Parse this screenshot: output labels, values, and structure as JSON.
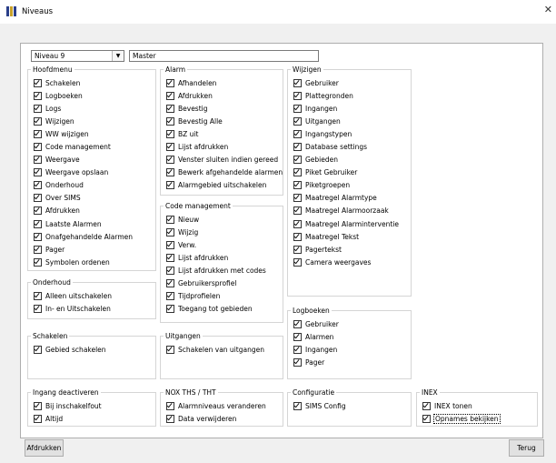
{
  "window": {
    "title": "Niveaus",
    "close_glyph": "✕"
  },
  "level_select": {
    "value": "Niveau 9"
  },
  "level_name": {
    "value": "Master"
  },
  "groups": {
    "hoofdmenu": {
      "title": "Hoofdmenu",
      "items": [
        "Schakelen",
        "Logboeken",
        "Logs",
        "Wijzigen",
        "WW wijzigen",
        "Code management",
        "Weergave",
        "Weergave opslaan",
        "Onderhoud",
        "Over SIMS",
        "Afdrukken",
        "Laatste Alarmen",
        "Onafgehandelde Alarmen",
        "Pager",
        "Symbolen ordenen"
      ]
    },
    "onderhoud": {
      "title": "Onderhoud",
      "items": [
        "Alleen uitschakelen",
        "In- en Uitschakelen"
      ]
    },
    "schakelen": {
      "title": "Schakelen",
      "items": [
        "Gebied schakelen"
      ]
    },
    "ingang": {
      "title": "Ingang deactiveren",
      "items": [
        "Bij inschakelfout",
        "Altijd"
      ]
    },
    "alarm": {
      "title": "Alarm",
      "items": [
        "Afhandelen",
        "Afdrukken",
        "Bevestig",
        "Bevestig Alle",
        "BZ uit",
        "Lijst afdrukken",
        "Venster sluiten indien gereed",
        "Bewerk afgehandelde alarmen",
        "Alarmgebied uitschakelen"
      ]
    },
    "code": {
      "title": "Code management",
      "items": [
        "Nieuw",
        "Wijzig",
        "Verw.",
        "Lijst afdrukken",
        "Lijst afdrukken met codes",
        "Gebruikersprofiel",
        "Tijdprofielen",
        "Toegang tot gebieden"
      ]
    },
    "uitgangen": {
      "title": "Uitgangen",
      "items": [
        "Schakelen van uitgangen"
      ]
    },
    "nox": {
      "title": "NOX THS / THT",
      "items": [
        "Alarmniveaus veranderen",
        "Data verwijderen"
      ]
    },
    "wijzigen": {
      "title": "Wijzigen",
      "items": [
        "Gebruiker",
        "Plattegronden",
        "Ingangen",
        "Uitgangen",
        "Ingangstypen",
        "Database settings",
        "Gebieden",
        "Piket Gebruiker",
        "Piketgroepen",
        "Maatregel Alarmtype",
        "Maatregel Alarmoorzaak",
        "Maatregel Alarminterventie",
        "Maatregel Tekst",
        "Pagertekst",
        "Camera weergaves"
      ]
    },
    "logboeken": {
      "title": "Logboeken",
      "items": [
        "Gebruiker",
        "Alarmen",
        "Ingangen",
        "Pager"
      ]
    },
    "configuratie": {
      "title": "Configuratie",
      "items": [
        "SIMS Config"
      ]
    },
    "inex": {
      "title": "INEX",
      "items": [
        "INEX tonen",
        "Opnames bekijken"
      ]
    }
  },
  "buttons": {
    "print": "Afdrukken",
    "back": "Terug"
  },
  "colors": {
    "window_bg": "#f0f0f0",
    "panel_bg": "#ffffff",
    "group_border": "#d5d5d5"
  }
}
